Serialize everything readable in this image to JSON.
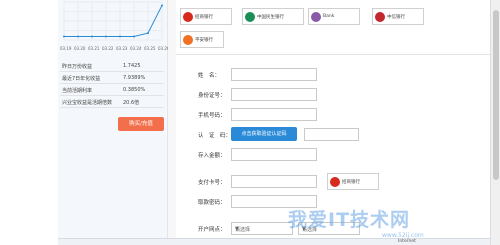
{
  "chart_data": {
    "type": "line",
    "title": "",
    "xlabel": "",
    "ylabel": "",
    "categories": [
      "03.19",
      "03.20",
      "03.21",
      "03.22",
      "03.23",
      "03.24",
      "03.25",
      "03.26"
    ],
    "series": [
      {
        "values": [
          2.2,
          2.2,
          2.2,
          2.2,
          2.2,
          2.2,
          2.4,
          4.0
        ]
      }
    ],
    "ylim": [
      2.0,
      4.2
    ],
    "grid": true,
    "colors": {
      "line": "#2a8ad8",
      "grid": "#dde3ea"
    }
  },
  "metrics": [
    {
      "label": "昨日万份收益",
      "value": "1.7425"
    },
    {
      "label": "最近7日年化收益",
      "value": "7.9389%"
    },
    {
      "label": "当前活期利率",
      "value": "0.3850%"
    },
    {
      "label": "兴业宝收益是活期倍数",
      "value": "20.6倍"
    }
  ],
  "buy_button": "购买/充值",
  "banks": [
    {
      "name": "招商银行",
      "icon": "cmb-logo-icon",
      "color": "#d7291c"
    },
    {
      "name": "中国民生银行",
      "icon": "cmbc-logo-icon",
      "color": "#1c8e55"
    },
    {
      "name": "Bank",
      "icon": "ceb-logo-icon",
      "color": "#8a5aa6"
    },
    {
      "name": "中信银行",
      "icon": "citic-logo-icon",
      "color": "#c1272d"
    },
    {
      "name": "平安银行",
      "icon": "pingan-logo-icon",
      "color": "#f36f21"
    }
  ],
  "form": {
    "name_label": "姓　名：",
    "id_label": "身份证号：",
    "phone_label": "手机号码：",
    "verify_label": "认　证　码：",
    "verify_button": "点击获取验证认证码",
    "amount_label": "存入金额：",
    "card_label": "支付卡号：",
    "card_bank": "招商银行",
    "password_label": "取款密码：",
    "branch_label": "开户网点：",
    "select_placeholder_1": "请选择",
    "select_placeholder_2": "请选择"
  },
  "watermark": {
    "text": "我爱IT技术网",
    "url": "www.52ij.com"
  },
  "status_bar": {
    "text": "Internet"
  }
}
